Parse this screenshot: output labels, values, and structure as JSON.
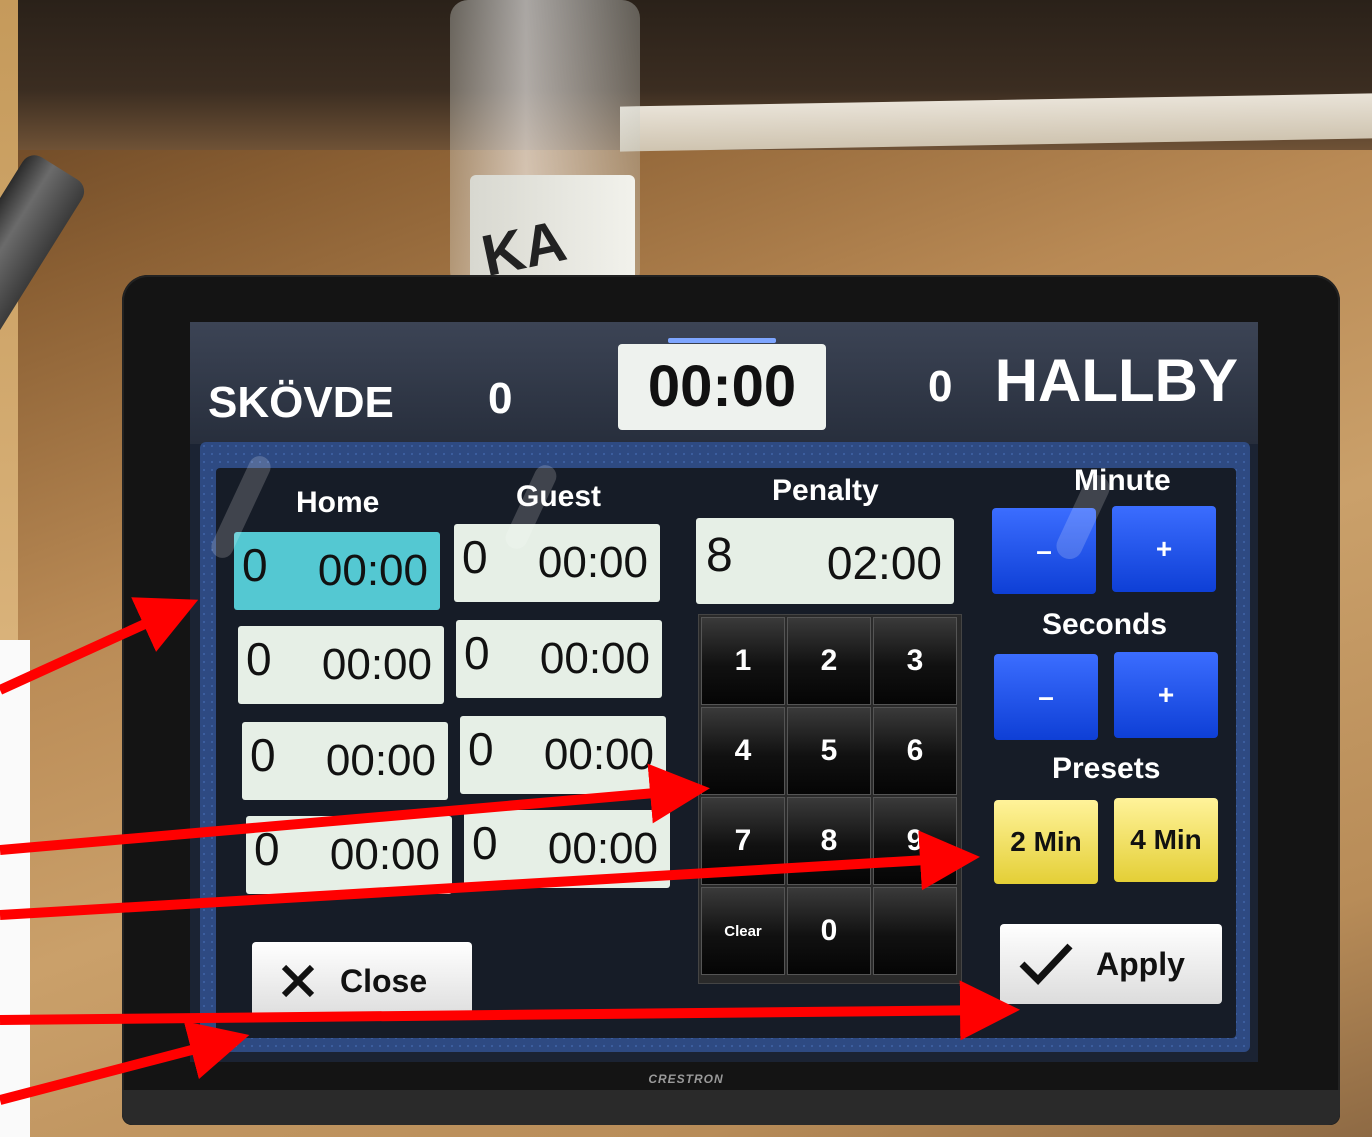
{
  "scoreboard": {
    "home_team": "SKÖVDE",
    "home_score": "0",
    "clock": "00:00",
    "guest_score": "0",
    "guest_team": "HALLBY"
  },
  "penalty_panel": {
    "home_header": "Home",
    "guest_header": "Guest",
    "penalty_header": "Penalty",
    "home_slots": [
      {
        "number": "0",
        "time": "00:00"
      },
      {
        "number": "0",
        "time": "00:00"
      },
      {
        "number": "0",
        "time": "00:00"
      },
      {
        "number": "0",
        "time": "00:00"
      }
    ],
    "guest_slots": [
      {
        "number": "0",
        "time": "00:00"
      },
      {
        "number": "0",
        "time": "00:00"
      },
      {
        "number": "0",
        "time": "00:00"
      },
      {
        "number": "0",
        "time": "00:00"
      }
    ],
    "penalty_entry": {
      "number": "8",
      "time": "02:00"
    },
    "keypad": [
      "1",
      "2",
      "3",
      "4",
      "5",
      "6",
      "7",
      "8",
      "9",
      "Clear",
      "0",
      ""
    ],
    "minute_label": "Minute",
    "seconds_label": "Seconds",
    "minus": "–",
    "plus": "+",
    "presets_label": "Presets",
    "preset_2": "2 Min",
    "preset_4": "4 Min",
    "close_label": "Close",
    "apply_label": "Apply"
  },
  "device": {
    "brand": "CRESTRON",
    "bottle_text": "KA"
  },
  "colors": {
    "active_slot": "#54c8d2",
    "blue_button": "#1d50f0",
    "preset_yellow": "#efe05a",
    "arrow_red": "#ff0000"
  }
}
